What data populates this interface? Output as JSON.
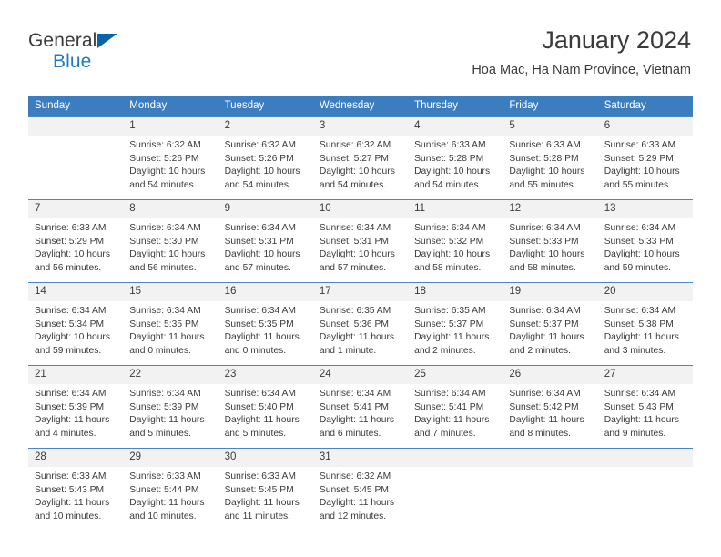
{
  "brand": {
    "name_part1": "General",
    "name_part2": "Blue"
  },
  "header": {
    "title": "January 2024",
    "subtitle": "Hoa Mac, Ha Nam Province, Vietnam"
  },
  "colors": {
    "header_blue": "#3b7dbf",
    "row_line_blue": "#4a86c5",
    "daynum_bg": "#f2f2f2",
    "brand_blue": "#1d7cc4",
    "text": "#3a3a3a"
  },
  "weekday_headers": [
    "Sunday",
    "Monday",
    "Tuesday",
    "Wednesday",
    "Thursday",
    "Friday",
    "Saturday"
  ],
  "weeks": [
    [
      {
        "day": "",
        "empty": true,
        "lines": []
      },
      {
        "day": "1",
        "lines": [
          "Sunrise: 6:32 AM",
          "Sunset: 5:26 PM",
          "Daylight: 10 hours",
          "and 54 minutes."
        ]
      },
      {
        "day": "2",
        "lines": [
          "Sunrise: 6:32 AM",
          "Sunset: 5:26 PM",
          "Daylight: 10 hours",
          "and 54 minutes."
        ]
      },
      {
        "day": "3",
        "lines": [
          "Sunrise: 6:32 AM",
          "Sunset: 5:27 PM",
          "Daylight: 10 hours",
          "and 54 minutes."
        ]
      },
      {
        "day": "4",
        "lines": [
          "Sunrise: 6:33 AM",
          "Sunset: 5:28 PM",
          "Daylight: 10 hours",
          "and 54 minutes."
        ]
      },
      {
        "day": "5",
        "lines": [
          "Sunrise: 6:33 AM",
          "Sunset: 5:28 PM",
          "Daylight: 10 hours",
          "and 55 minutes."
        ]
      },
      {
        "day": "6",
        "lines": [
          "Sunrise: 6:33 AM",
          "Sunset: 5:29 PM",
          "Daylight: 10 hours",
          "and 55 minutes."
        ]
      }
    ],
    [
      {
        "day": "7",
        "lines": [
          "Sunrise: 6:33 AM",
          "Sunset: 5:29 PM",
          "Daylight: 10 hours",
          "and 56 minutes."
        ]
      },
      {
        "day": "8",
        "lines": [
          "Sunrise: 6:34 AM",
          "Sunset: 5:30 PM",
          "Daylight: 10 hours",
          "and 56 minutes."
        ]
      },
      {
        "day": "9",
        "lines": [
          "Sunrise: 6:34 AM",
          "Sunset: 5:31 PM",
          "Daylight: 10 hours",
          "and 57 minutes."
        ]
      },
      {
        "day": "10",
        "lines": [
          "Sunrise: 6:34 AM",
          "Sunset: 5:31 PM",
          "Daylight: 10 hours",
          "and 57 minutes."
        ]
      },
      {
        "day": "11",
        "lines": [
          "Sunrise: 6:34 AM",
          "Sunset: 5:32 PM",
          "Daylight: 10 hours",
          "and 58 minutes."
        ]
      },
      {
        "day": "12",
        "lines": [
          "Sunrise: 6:34 AM",
          "Sunset: 5:33 PM",
          "Daylight: 10 hours",
          "and 58 minutes."
        ]
      },
      {
        "day": "13",
        "lines": [
          "Sunrise: 6:34 AM",
          "Sunset: 5:33 PM",
          "Daylight: 10 hours",
          "and 59 minutes."
        ]
      }
    ],
    [
      {
        "day": "14",
        "lines": [
          "Sunrise: 6:34 AM",
          "Sunset: 5:34 PM",
          "Daylight: 10 hours",
          "and 59 minutes."
        ]
      },
      {
        "day": "15",
        "lines": [
          "Sunrise: 6:34 AM",
          "Sunset: 5:35 PM",
          "Daylight: 11 hours",
          "and 0 minutes."
        ]
      },
      {
        "day": "16",
        "lines": [
          "Sunrise: 6:34 AM",
          "Sunset: 5:35 PM",
          "Daylight: 11 hours",
          "and 0 minutes."
        ]
      },
      {
        "day": "17",
        "lines": [
          "Sunrise: 6:35 AM",
          "Sunset: 5:36 PM",
          "Daylight: 11 hours",
          "and 1 minute."
        ]
      },
      {
        "day": "18",
        "lines": [
          "Sunrise: 6:35 AM",
          "Sunset: 5:37 PM",
          "Daylight: 11 hours",
          "and 2 minutes."
        ]
      },
      {
        "day": "19",
        "lines": [
          "Sunrise: 6:34 AM",
          "Sunset: 5:37 PM",
          "Daylight: 11 hours",
          "and 2 minutes."
        ]
      },
      {
        "day": "20",
        "lines": [
          "Sunrise: 6:34 AM",
          "Sunset: 5:38 PM",
          "Daylight: 11 hours",
          "and 3 minutes."
        ]
      }
    ],
    [
      {
        "day": "21",
        "lines": [
          "Sunrise: 6:34 AM",
          "Sunset: 5:39 PM",
          "Daylight: 11 hours",
          "and 4 minutes."
        ]
      },
      {
        "day": "22",
        "lines": [
          "Sunrise: 6:34 AM",
          "Sunset: 5:39 PM",
          "Daylight: 11 hours",
          "and 5 minutes."
        ]
      },
      {
        "day": "23",
        "lines": [
          "Sunrise: 6:34 AM",
          "Sunset: 5:40 PM",
          "Daylight: 11 hours",
          "and 5 minutes."
        ]
      },
      {
        "day": "24",
        "lines": [
          "Sunrise: 6:34 AM",
          "Sunset: 5:41 PM",
          "Daylight: 11 hours",
          "and 6 minutes."
        ]
      },
      {
        "day": "25",
        "lines": [
          "Sunrise: 6:34 AM",
          "Sunset: 5:41 PM",
          "Daylight: 11 hours",
          "and 7 minutes."
        ]
      },
      {
        "day": "26",
        "lines": [
          "Sunrise: 6:34 AM",
          "Sunset: 5:42 PM",
          "Daylight: 11 hours",
          "and 8 minutes."
        ]
      },
      {
        "day": "27",
        "lines": [
          "Sunrise: 6:34 AM",
          "Sunset: 5:43 PM",
          "Daylight: 11 hours",
          "and 9 minutes."
        ]
      }
    ],
    [
      {
        "day": "28",
        "lines": [
          "Sunrise: 6:33 AM",
          "Sunset: 5:43 PM",
          "Daylight: 11 hours",
          "and 10 minutes."
        ]
      },
      {
        "day": "29",
        "lines": [
          "Sunrise: 6:33 AM",
          "Sunset: 5:44 PM",
          "Daylight: 11 hours",
          "and 10 minutes."
        ]
      },
      {
        "day": "30",
        "lines": [
          "Sunrise: 6:33 AM",
          "Sunset: 5:45 PM",
          "Daylight: 11 hours",
          "and 11 minutes."
        ]
      },
      {
        "day": "31",
        "lines": [
          "Sunrise: 6:32 AM",
          "Sunset: 5:45 PM",
          "Daylight: 11 hours",
          "and 12 minutes."
        ]
      },
      {
        "day": "",
        "empty": true,
        "lines": []
      },
      {
        "day": "",
        "empty": true,
        "lines": []
      },
      {
        "day": "",
        "empty": true,
        "lines": []
      }
    ]
  ]
}
